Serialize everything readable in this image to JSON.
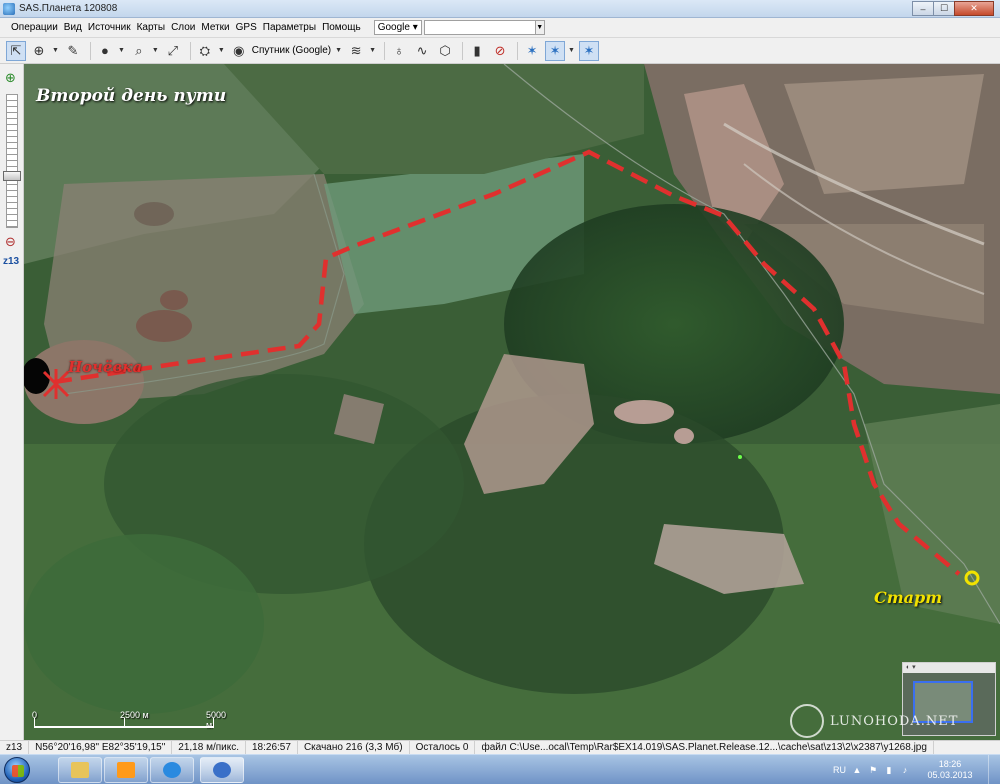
{
  "window": {
    "title": "SAS.Планета 120808",
    "buttons": {
      "minimize": "–",
      "maximize": "☐",
      "close": "✕"
    }
  },
  "menu": {
    "items": [
      "Операции",
      "Вид",
      "Источник",
      "Карты",
      "Слои",
      "Метки",
      "GPS",
      "Параметры",
      "Помощь"
    ],
    "search_engine": "Google ▾",
    "search_value": ""
  },
  "toolbar": {
    "map_type_label": "Спутник (Google)",
    "icons": [
      "cursor-icon",
      "globe-icon",
      "ruler-icon",
      "earth-icon",
      "zoom-icon",
      "fullscreen-icon",
      "satellite-icon",
      "layers-icon",
      "pin-icon",
      "path-icon",
      "polygon-icon",
      "mark-icon",
      "stop-icon",
      "gps-icon",
      "gps-track-icon",
      "gps-center-icon"
    ]
  },
  "zoom": {
    "level": "z13",
    "slider_fraction": 0.62
  },
  "map": {
    "caption": "Второй день пути",
    "labels": {
      "camp": "Ночёвка",
      "start": "Старт"
    },
    "route_color": "#e0302e",
    "start_marker_color": "#f2e200",
    "scale": {
      "zero": "0",
      "mid": "2500 м",
      "end": "5000 м"
    },
    "watermark": "LUNOHODA.NET"
  },
  "status": {
    "zoom": "z13",
    "coords": "N56°20'16,98\" E82°35'19,15\"",
    "resolution": "21,18 м/пикс.",
    "time": "18:26:57",
    "downloaded": "Скачано 216 (3,3 Мб)",
    "remaining": "Осталось 0",
    "file": "файл C:\\Use...ocal\\Temp\\Rar$EX14.019\\SAS.Planet.Release.12...\\cache\\sat\\z13\\2\\x2387\\y1268.jpg"
  },
  "taskbar": {
    "lang": "RU",
    "clock_time": "18:26",
    "clock_date": "05.03.2013"
  }
}
